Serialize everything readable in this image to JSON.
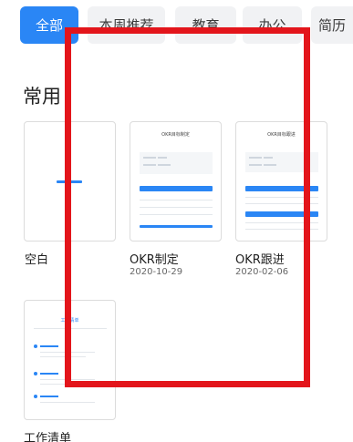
{
  "tabs": [
    {
      "label": "全部",
      "active": true
    },
    {
      "label": "本周推荐",
      "active": false
    },
    {
      "label": "教育",
      "active": false
    },
    {
      "label": "办公",
      "active": false
    },
    {
      "label": "简历",
      "active": false
    }
  ],
  "section": {
    "title": "常用"
  },
  "templates": [
    {
      "title": "空白",
      "date": ""
    },
    {
      "title": "OKR制定",
      "date": "2020-10-29",
      "thumb_title": "OKR目标制定"
    },
    {
      "title": "OKR跟进",
      "date": "2020-02-06",
      "thumb_title": "OKR目标跟进"
    },
    {
      "title": "工作清单",
      "date": "",
      "thumb_title": "工作清单"
    }
  ],
  "colors": {
    "accent": "#2a86f5",
    "annotation": "#e3151b"
  }
}
